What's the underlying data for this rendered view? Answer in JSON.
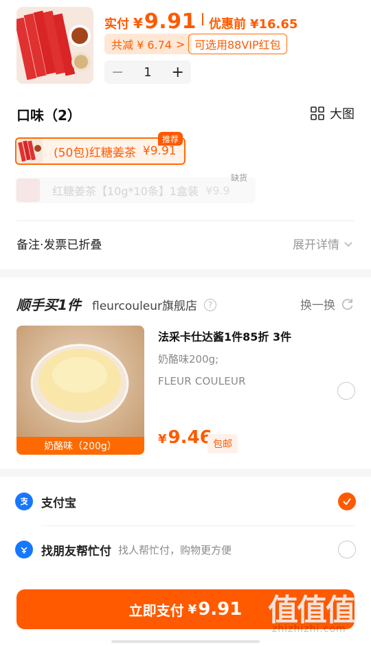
{
  "top": {
    "price_label": "实付",
    "currency": "¥",
    "price": "9.91",
    "original_label": "优惠前",
    "original_price": "¥16.65",
    "discount_text": "共减 ¥ 6.74",
    "discount_chevron": ">",
    "vip_text": "可选用88VIP红包",
    "quantity": "1",
    "minus": "−",
    "plus": "+"
  },
  "flavor": {
    "title": "口味（2）",
    "big_image_label": "大图",
    "options": [
      {
        "label": "(50包)红糖姜茶",
        "price": "¥9.91",
        "badge": "推荐",
        "selected": true
      },
      {
        "label": "红糖姜茶【10g*10条】1盒装",
        "price": "¥9.9",
        "badge": "缺货",
        "disabled": true
      }
    ]
  },
  "remark": {
    "label": "备注·发票已折叠",
    "expand_label": "展开详情"
  },
  "addon": {
    "title": "顺手买1件",
    "shop": "fleurcouleur旗舰店",
    "help": "?",
    "swap_label": "换一换",
    "item": {
      "name": "法采卡仕达酱1件85折 3件",
      "spec": "奶酪味200g;",
      "brand": "FLEUR COULEUR",
      "caption": "奶酪味（200g）",
      "currency": "¥",
      "price": "9.46",
      "shipping": "包邮"
    }
  },
  "payment": {
    "methods": [
      {
        "name": "支付宝",
        "icon": "alipay-icon",
        "selected": true
      },
      {
        "name": "找朋友帮忙付",
        "desc": "找人帮忙付，购物更方便",
        "icon": "friend-pay-icon",
        "selected": false
      }
    ]
  },
  "bottom": {
    "pay_label": "立即支付",
    "currency": "¥",
    "price": "9.91"
  },
  "watermark": {
    "big": "值值值",
    "small": "zhizhizhi.com"
  },
  "colors": {
    "accent": "#ff5a00",
    "accent_light": "#ffe7d6",
    "alipay_blue": "#1677ff"
  }
}
